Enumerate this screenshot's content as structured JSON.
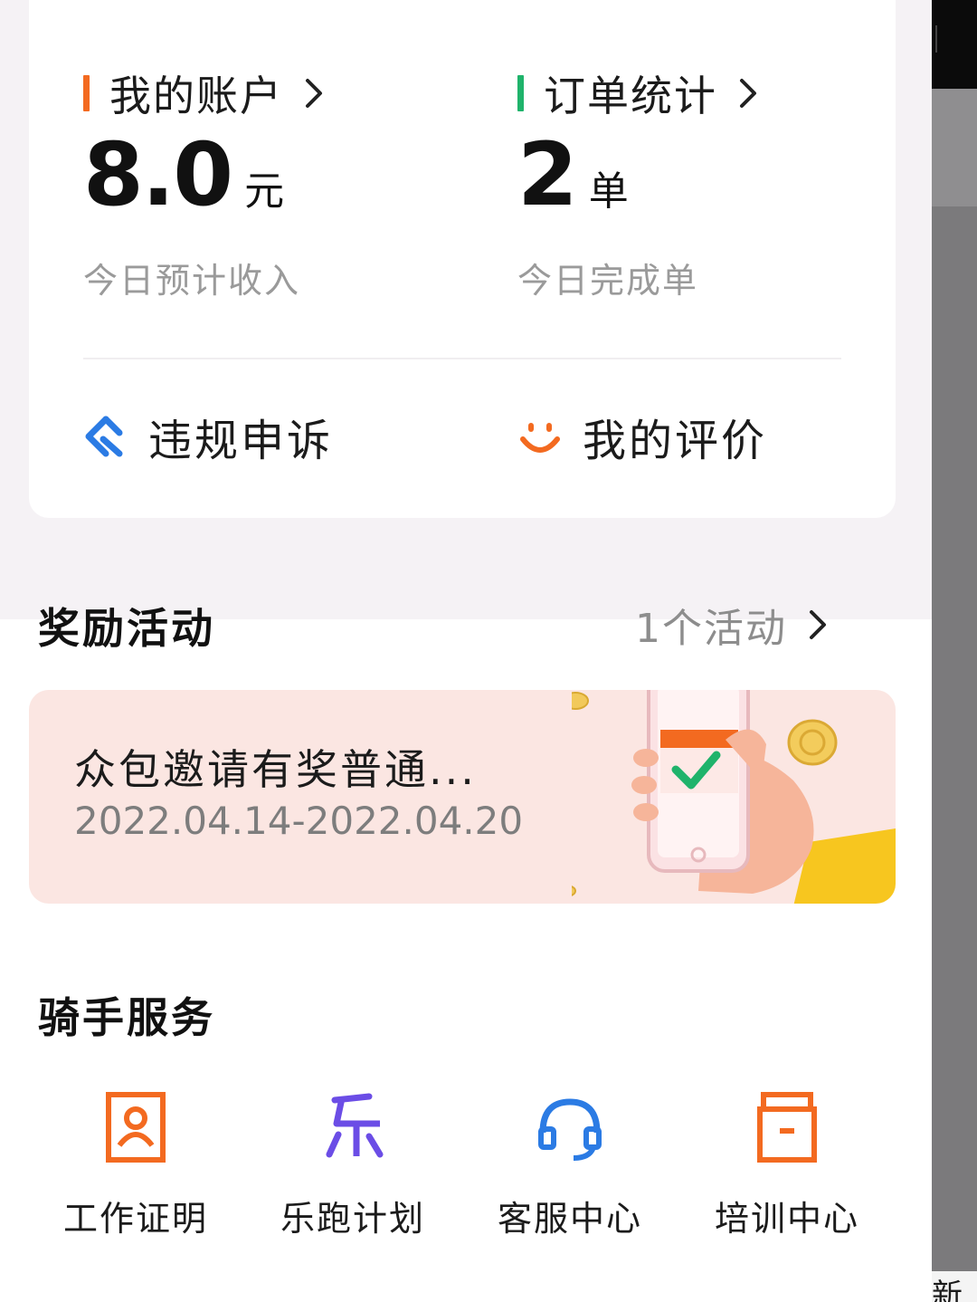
{
  "account": {
    "title": "我的账户",
    "value": "8.0",
    "unit": "元",
    "subtitle": "今日预计收入"
  },
  "orders": {
    "title": "订单统计",
    "value": "2",
    "unit": "单",
    "subtitle": "今日完成单"
  },
  "actions": {
    "appeal_label": "违规申诉",
    "review_label": "我的评价"
  },
  "rewards": {
    "title": "奖励活动",
    "link_text": "1个活动",
    "banner": {
      "title": "众包邀请有奖普通...",
      "date_range": "2022.04.14-2022.04.20"
    }
  },
  "rider_services": {
    "title": "骑手服务",
    "items": [
      {
        "label": "工作证明",
        "icon": "id-badge-icon",
        "color": "#f36a20"
      },
      {
        "label": "乐跑计划",
        "icon": "le-run-icon",
        "color": "#6b4de6"
      },
      {
        "label": "客服中心",
        "icon": "headset-icon",
        "color": "#2b7be4"
      },
      {
        "label": "培训中心",
        "icon": "training-box-icon",
        "color": "#f36a20"
      }
    ]
  },
  "edge_text": "新",
  "colors": {
    "orange": "#f36a20",
    "green": "#1fb36b",
    "blue": "#2b7be4",
    "purple": "#6b4de6",
    "banner_bg": "#fbe6e2"
  }
}
